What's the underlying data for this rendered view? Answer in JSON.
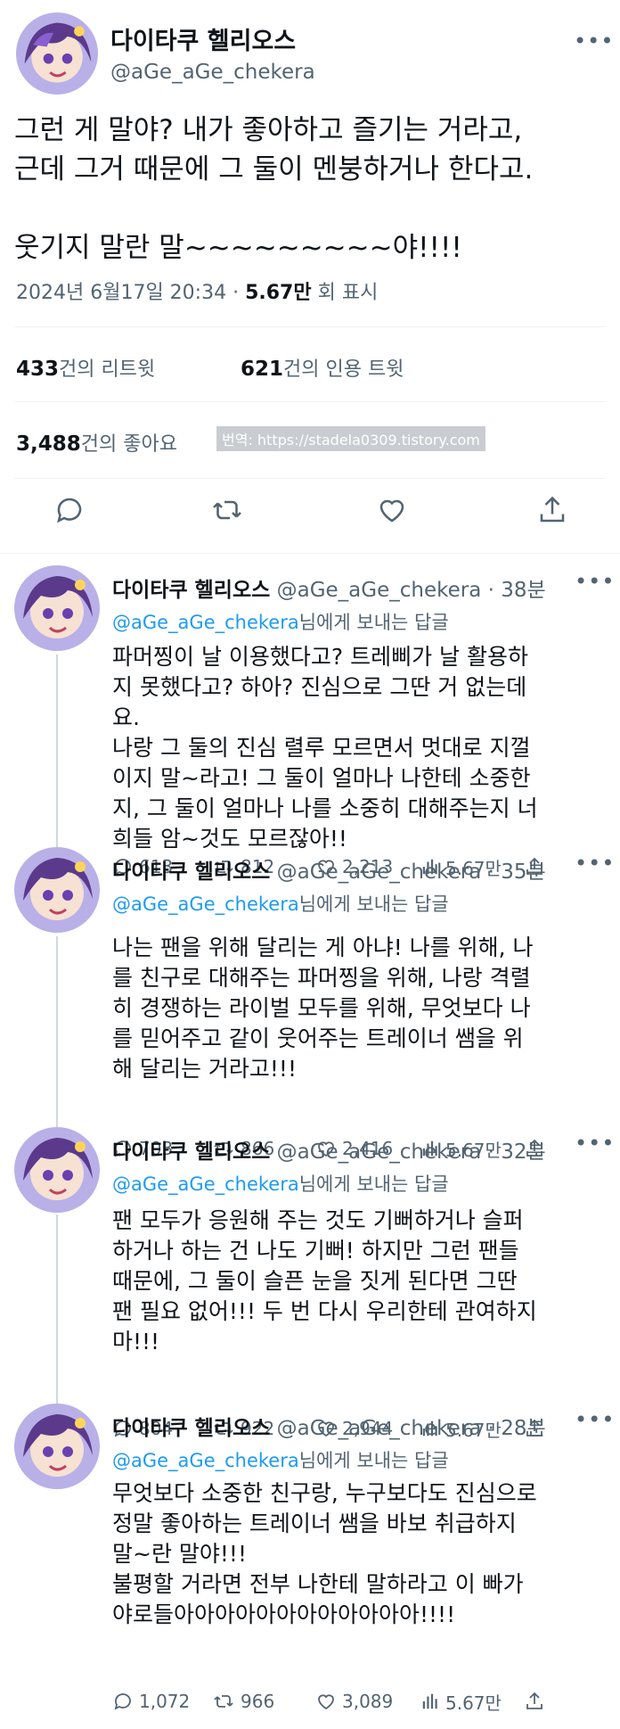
{
  "main": {
    "name": "다이타쿠 헬리오스",
    "handle": "@aGe_aGe_chekera",
    "text": "그런 게 말야? 내가 좋아하고 즐기는 거라고,\n근데 그거 때문에 그 둘이 멘붕하거나 한다고.\n\n웃기지 말란 말~~~~~~~~~야!!!!",
    "time": "2024년 6월17일 20:34 · ",
    "views": "5.67만",
    "views_label": " 회 표시",
    "retweets": "433",
    "retweets_label": "건의 리트윗",
    "quotes": "621",
    "quotes_label": "건의 인용 트윗",
    "likes": "3,488",
    "likes_label": "건의 좋아요",
    "watermark": "번역: https://stadela0309.tistory.com"
  },
  "reply_to_suffix": "님에게 보내는 답글",
  "replies": [
    {
      "name": "다이타쿠 헬리오스",
      "handle": "@aGe_aGe_chekera · 38분",
      "mention": "@aGe_aGe_chekera",
      "text": "파머찡이 날 이용했다고? 트레삐가 날 활용하\n지 못했다고? 하아? 진심으로 그딴 거 없는데\n요.\n나랑 그 둘의 진심 렬루 모르면서 멋대로 지껄\n이지 말~라고! 그 둘이 얼마나 나한테 소중한\n지, 그 둘이 얼마나 나를 소중히 대해주는지 너\n희들 암~것도 모르잖아!!",
      "replies": "613",
      "retweets": "812",
      "likes": "2,213",
      "views": "5.67만"
    },
    {
      "name": "다이타쿠 헬리오스",
      "handle": "@aGe_aGe_chekera · 35분",
      "mention": "@aGe_aGe_chekera",
      "text": "나는 팬을 위해 달리는 게 아냐! 나를 위해, 나\n를 친구로 대해주는 파머찡을 위해, 나랑 격렬\n히 경쟁하는 라이벌 모두를 위해, 무엇보다 나\n를 믿어주고 같이 웃어주는 트레이너 쌤을 위\n해 달리는 거라고!!!",
      "replies": "703",
      "retweets": "866",
      "likes": "2,416",
      "views": "5.67만"
    },
    {
      "name": "다이타쿠 헬리오스",
      "handle": "@aGe_aGe_chekera · 32분",
      "mention": "@aGe_aGe_chekera",
      "text": "팬 모두가 응원해 주는 것도 기뻐하거나 슬퍼\n하거나 하는 건 나도 기뻐! 하지만 그런 팬들\n때문에, 그 둘이 슬픈 눈을 짓게 된다면 그딴\n팬 필요 없어!!! 두 번 다시 우리한테 관여하지\n마!!!",
      "replies": "804",
      "retweets": "922",
      "likes": "2,944",
      "views": "5.67만"
    },
    {
      "name": "다이타쿠 헬리오스",
      "handle": "@aGe_aGe_chekera · 28분",
      "mention": "@aGe_aGe_chekera",
      "text": "무엇보다 소중한 친구랑, 누구보다도 진심으로\n정말 좋아하는 트레이너 쌤을 바보 취급하지\n말~란 말야!!!\n불평할 거라면 전부 나한테 말하라고 이 빠가\n야로들아아아아아아아아아아아아!!!!",
      "replies": "1,072",
      "retweets": "966",
      "likes": "3,089",
      "views": "5.67만"
    }
  ]
}
